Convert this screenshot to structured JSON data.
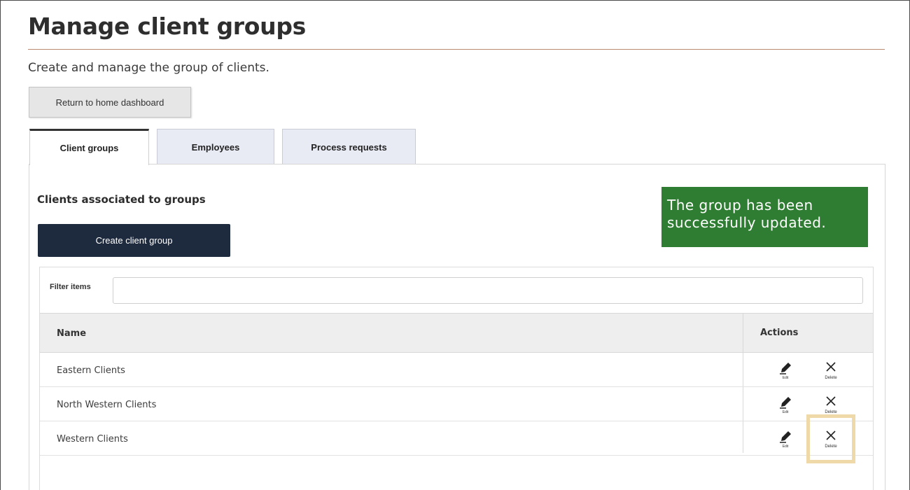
{
  "page": {
    "title": "Manage client groups",
    "subtitle": "Create and manage the group of clients.",
    "return_button_label": "Return to home dashboard"
  },
  "tabs": [
    {
      "label": "Client groups",
      "active": true
    },
    {
      "label": "Employees",
      "active": false
    },
    {
      "label": "Process requests",
      "active": false
    }
  ],
  "section": {
    "heading": "Clients associated to groups",
    "create_button_label": "Create client group"
  },
  "notification": {
    "line1": "The group has been",
    "line2": "successfully updated.",
    "color": "#2e7d32"
  },
  "filter": {
    "label": "Filter items",
    "value": "",
    "placeholder": ""
  },
  "table": {
    "columns": [
      "Name",
      "Actions"
    ],
    "rows": [
      {
        "name": "Eastern Clients"
      },
      {
        "name": "North Western Clients"
      },
      {
        "name": "Western Clients"
      }
    ],
    "edit_label": "Edit",
    "delete_label": "Delete"
  },
  "icons": {
    "edit": "pencil-icon",
    "delete": "x-icon"
  },
  "colors": {
    "primary_button": "#1e2a3d",
    "title_rule": "#b98a6f",
    "highlight": "#f0d9a8"
  }
}
